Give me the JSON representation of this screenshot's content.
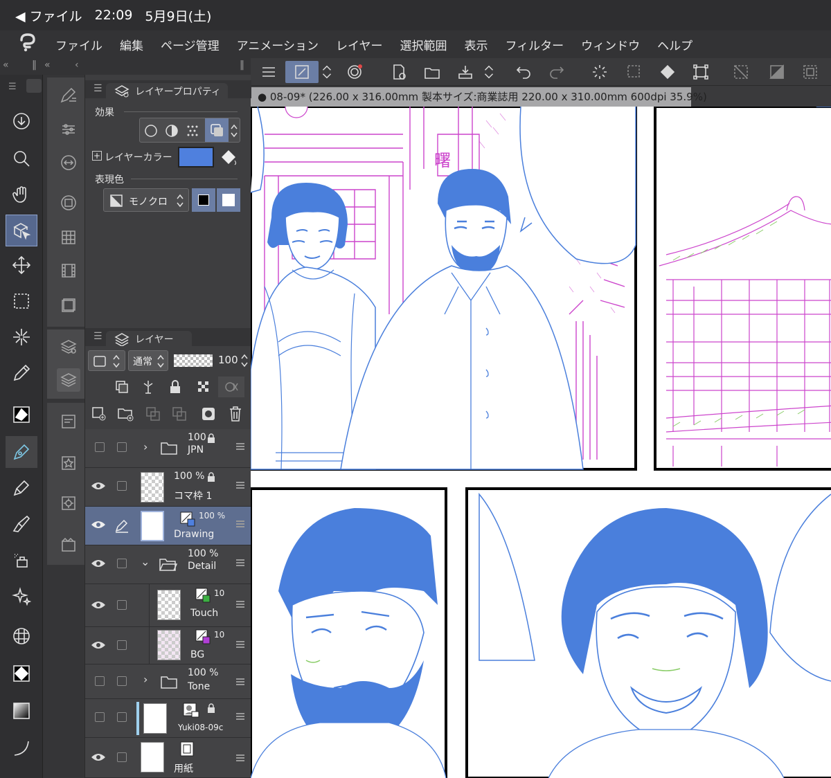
{
  "status": {
    "back": "◀ ファイル",
    "time": "22:09",
    "date": "5月9日(土)"
  },
  "menu": [
    "ファイル",
    "編集",
    "ページ管理",
    "アニメーション",
    "レイヤー",
    "選択範囲",
    "表示",
    "フィルター",
    "ウィンドウ",
    "ヘルプ"
  ],
  "doc_tab": "● 08-09* (226.00 x 316.00mm 製本サイズ:商業誌用 220.00 x 310.00mm 600dpi 35.9%)",
  "layer_property": {
    "title": "レイヤープロパティ",
    "effect": "効果",
    "layer_color": "レイヤーカラー",
    "expression_color": "表現色",
    "mode": "モノクロ",
    "layer_color_value": "#4f80de"
  },
  "layer_panel": {
    "title": "レイヤー",
    "blend": "通常",
    "opacity": "100",
    "layers": [
      {
        "pct": "100",
        "name": "JPN",
        "kind": "folder"
      },
      {
        "pct": "100 %",
        "name": "コマ枠 1",
        "kind": "layer"
      },
      {
        "pct": "100 %",
        "name": "Drawing",
        "kind": "layer"
      },
      {
        "pct": "100 %",
        "name": "Detail",
        "kind": "folder"
      },
      {
        "pct": "10",
        "name": "Touch",
        "kind": "layer"
      },
      {
        "pct": "10",
        "name": "BG",
        "kind": "layer"
      },
      {
        "pct": "100 %",
        "name": "Tone",
        "kind": "folder"
      },
      {
        "pct": "",
        "name": "Yuki08-09c",
        "kind": "layer"
      },
      {
        "pct": "",
        "name": "用紙",
        "kind": "layer"
      }
    ]
  },
  "canvas_text": {
    "sign": "曙"
  },
  "colors": {
    "ink": "#4a7fdc",
    "accent": "#6b7ea5",
    "pink": "#cc44cc",
    "tone_green": "#88cc66"
  }
}
